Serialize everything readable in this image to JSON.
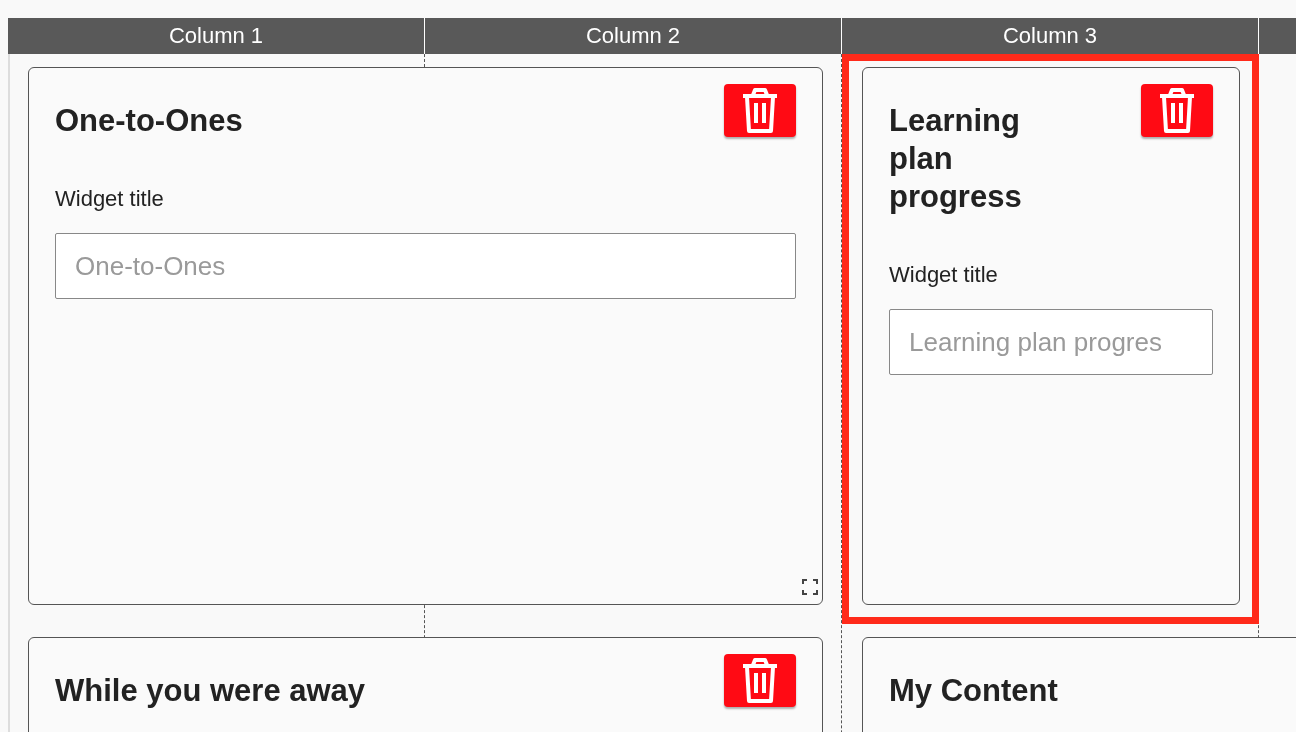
{
  "columns": [
    {
      "label": "Column 1"
    },
    {
      "label": "Column 2"
    },
    {
      "label": "Column 3"
    }
  ],
  "widgets": [
    {
      "kind": "wide",
      "title": "One-to-Ones",
      "field_label": "Widget title",
      "placeholder": "One-to-Ones",
      "deletable": true,
      "resizable": true,
      "selected": false
    },
    {
      "kind": "narrow",
      "title": "Learning plan progress",
      "field_label": "Widget title",
      "placeholder": "Learning plan progres",
      "deletable": true,
      "resizable": false,
      "selected": true
    },
    {
      "kind": "wide",
      "title": "While you were away",
      "deletable": true,
      "selected": false
    },
    {
      "kind": "wide",
      "title": "My Content",
      "selected": false
    }
  ]
}
